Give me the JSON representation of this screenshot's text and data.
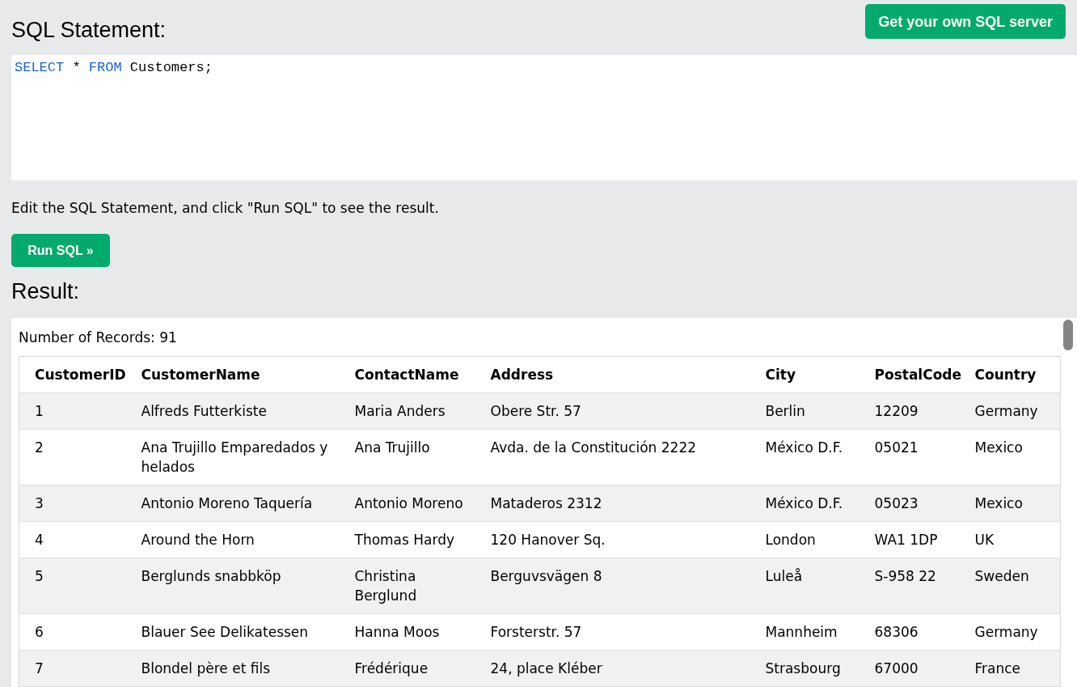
{
  "header": {
    "title": "SQL Statement:",
    "server_button": "Get your own SQL server"
  },
  "editor": {
    "tokens": [
      {
        "text": "SELECT",
        "kind": "keyword"
      },
      {
        "text": "*",
        "kind": "text"
      },
      {
        "text": "FROM",
        "kind": "keyword"
      },
      {
        "text": "Customers;",
        "kind": "text"
      }
    ]
  },
  "hint": "Edit the SQL Statement, and click \"Run SQL\" to see the result.",
  "run_button": "Run SQL »",
  "result": {
    "title": "Result:",
    "record_count": "Number of Records: 91",
    "table": {
      "columns": [
        "CustomerID",
        "CustomerName",
        "ContactName",
        "Address",
        "City",
        "PostalCode",
        "Country"
      ],
      "rows": [
        [
          "1",
          "Alfreds Futterkiste",
          "Maria Anders",
          "Obere Str. 57",
          "Berlin",
          "12209",
          "Germany"
        ],
        [
          "2",
          "Ana Trujillo Emparedados y helados",
          "Ana Trujillo",
          "Avda. de la Constitución 2222",
          "México D.F.",
          "05021",
          "Mexico"
        ],
        [
          "3",
          "Antonio Moreno Taquería",
          "Antonio Moreno",
          "Mataderos 2312",
          "México D.F.",
          "05023",
          "Mexico"
        ],
        [
          "4",
          "Around the Horn",
          "Thomas Hardy",
          "120 Hanover Sq.",
          "London",
          "WA1 1DP",
          "UK"
        ],
        [
          "5",
          "Berglunds snabbköp",
          "Christina Berglund",
          "Berguvsvägen 8",
          "Luleå",
          "S-958 22",
          "Sweden"
        ],
        [
          "6",
          "Blauer See Delikatessen",
          "Hanna Moos",
          "Forsterstr. 57",
          "Mannheim",
          "68306",
          "Germany"
        ],
        [
          "7",
          "Blondel père et fils",
          "Frédérique",
          "24, place Kléber",
          "Strasbourg",
          "67000",
          "France"
        ]
      ]
    }
  }
}
